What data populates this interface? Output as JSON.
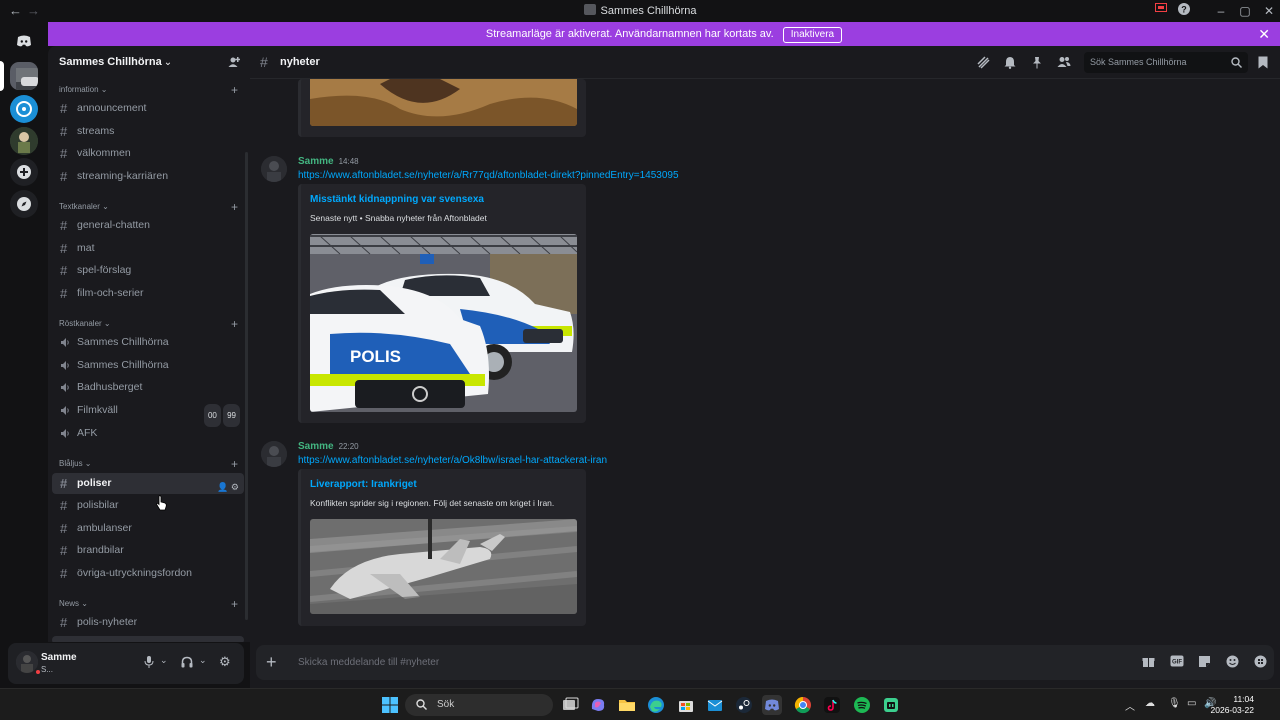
{
  "window": {
    "title": "Sammes Chillhörna"
  },
  "banner": {
    "text": "Streamarläge är aktiverat. Användarnamnen har kortats av.",
    "button": "Inaktivera",
    "color": "#9b3ee0"
  },
  "server": {
    "name": "Sammes Chillhörna"
  },
  "sidebar": {
    "categories": {
      "information": "information",
      "text": "Textkanaler",
      "voice": "Röstkanaler",
      "blaljus": "Blåljus",
      "news": "News"
    },
    "info_channels": [
      "announcement",
      "streams",
      "välkommen",
      "streaming-karriären"
    ],
    "text_channels": [
      "general-chatten",
      "mat",
      "spel-förslag",
      "film-och-serier"
    ],
    "voice_channels": [
      "Sammes Chillhörna",
      "Sammes Chillhörna",
      "Badhusberget",
      "Filmkväll",
      "AFK"
    ],
    "filmkvall_counts": [
      "00",
      "99"
    ],
    "blaljus_channels": [
      "poliser",
      "polisbilar",
      "ambulanser",
      "brandbilar",
      "övriga-utryckningsfordon"
    ],
    "news_channels": [
      "polis-nyheter"
    ],
    "active_channel": "poliser"
  },
  "user": {
    "name": "Samme",
    "status": "S..."
  },
  "channel": {
    "name": "nyheter",
    "search_placeholder": "Sök Sammes Chillhörna"
  },
  "messages": [
    {
      "author": "Samme",
      "time": "14:48",
      "link": "https://www.aftonbladet.se/nyheter/a/Rr77qd/aftonbladet-direkt?pinnedEntry=1453095",
      "embed_title": "Misstänkt kidnappning var svensexa",
      "embed_desc": "Senaste nytt • Snabba nyheter från Aftonbladet",
      "image_text": "POLIS"
    },
    {
      "author": "Samme",
      "time": "22:20",
      "link": "https://www.aftonbladet.se/nyheter/a/Ok8lbw/israel-har-attackerat-iran",
      "embed_title": "Liverapport: Irankriget",
      "embed_desc": "Konflikten sprider sig i regionen. Följ det senaste om kriget i Iran."
    }
  ],
  "composer": {
    "placeholder": "Skicka meddelande till #nyheter"
  },
  "taskbar": {
    "search": "Sök",
    "time": "11:04",
    "date": "2026-03-22"
  },
  "colors": {
    "accent_link": "#00a8fc",
    "author": "#43b581",
    "bg": "#1a1a1e"
  }
}
